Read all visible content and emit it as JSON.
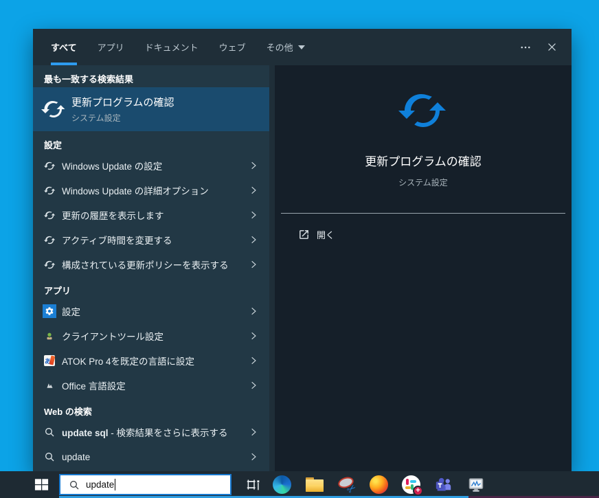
{
  "colors": {
    "desktop": "#0ca3e7",
    "accent_blue": "#0f80da",
    "selection": "#1a4b6e",
    "tab_underline": "#2e9bef",
    "taskbar": "#1e2a33"
  },
  "search_window": {
    "tabs": [
      "すべて",
      "アプリ",
      "ドキュメント",
      "ウェブ",
      "その他"
    ],
    "best_match_header": "最も一致する検索結果",
    "best_match": {
      "title": "更新プログラムの確認",
      "subtitle": "システム設定"
    },
    "settings_section": {
      "header": "設定",
      "items": [
        "Windows Update の設定",
        "Windows Update の詳細オプション",
        "更新の履歴を表示します",
        "アクティブ時間を変更する",
        "構成されている更新ポリシーを表示する"
      ]
    },
    "apps_section": {
      "header": "アプリ",
      "items": [
        "設定",
        "クライアントツール設定",
        "ATOK Pro 4を既定の言語に設定",
        "Office 言語設定"
      ]
    },
    "web_section": {
      "header": "Web の検索",
      "items": [
        {
          "query": "update sql",
          "suffix": " - 検索結果をさらに表示する"
        },
        {
          "query": "update",
          "suffix": ""
        }
      ]
    },
    "preview": {
      "title": "更新プログラムの確認",
      "subtitle": "システム設定",
      "open_label": "開く"
    },
    "atok_icon_glyph": "あ"
  },
  "taskbar": {
    "search_value": "update",
    "icons": [
      "start",
      "task-view",
      "edge",
      "file-explorer",
      "snipping-tool",
      "firefox",
      "slack",
      "teams",
      "performance-monitor"
    ]
  }
}
